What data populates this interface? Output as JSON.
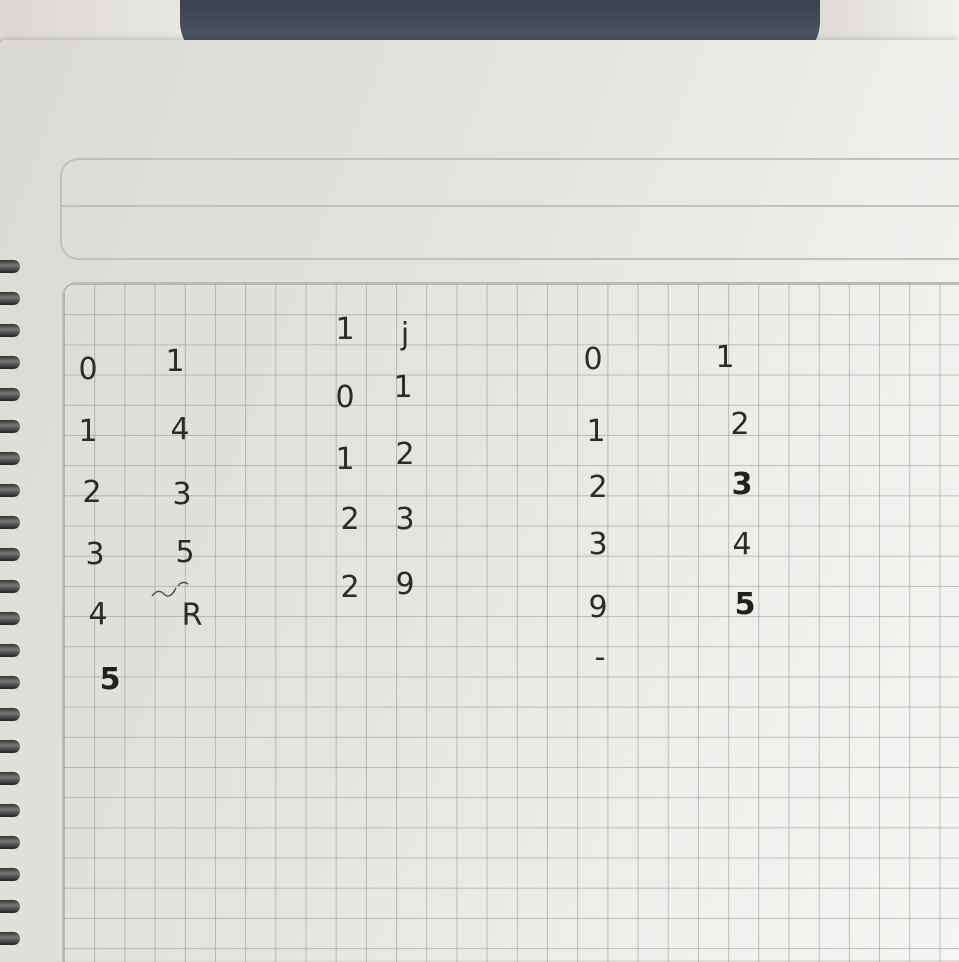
{
  "handwriting": {
    "col1": [
      "0",
      "1",
      "2",
      "3",
      "4",
      "5"
    ],
    "col2": [
      "1",
      "4",
      "3",
      "5",
      "R"
    ],
    "header_i": "1",
    "header_j": "j",
    "col3": [
      "0",
      "1",
      "2",
      "2"
    ],
    "col4": [
      "1",
      "2",
      "3",
      "9"
    ],
    "col5": [
      "0",
      "1",
      "2",
      "3",
      "9",
      "-"
    ],
    "col6": [
      "1",
      "2",
      "3",
      "4",
      "5"
    ]
  }
}
